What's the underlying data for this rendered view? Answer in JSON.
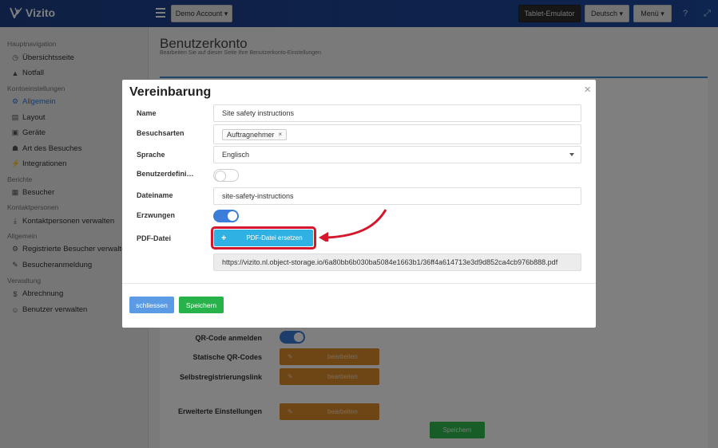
{
  "app": {
    "name": "Vizito"
  },
  "header": {
    "account_label": "Demo Account",
    "tablet_label": "Tablet-Emulator",
    "language_label": "Deutsch",
    "menu_label": "Menü"
  },
  "sidebar": {
    "sections": [
      {
        "title": "Hauptnavigation",
        "items": [
          {
            "label": "Übersichtsseite",
            "icon": "dashboard-icon"
          },
          {
            "label": "Notfall",
            "icon": "warning-icon"
          }
        ]
      },
      {
        "title": "Kontoeinstellungen",
        "items": [
          {
            "label": "Allgemein",
            "icon": "gear-icon",
            "active": true
          },
          {
            "label": "Layout",
            "icon": "layout-icon"
          },
          {
            "label": "Geräte",
            "icon": "device-icon"
          },
          {
            "label": "Art des Besuches",
            "icon": "users-icon"
          },
          {
            "label": "Integrationen",
            "icon": "plug-icon"
          }
        ]
      },
      {
        "title": "Berichte",
        "items": [
          {
            "label": "Besucher",
            "icon": "list-icon"
          }
        ]
      },
      {
        "title": "Kontaktpersonen",
        "items": [
          {
            "label": "Kontaktpersonen verwalten",
            "icon": "download-icon"
          }
        ]
      },
      {
        "title": "Allgemein",
        "items": [
          {
            "label": "Registrierte Besucher verwalten",
            "icon": "gear-icon"
          },
          {
            "label": "Besucheranmeldung",
            "icon": "pencil-icon"
          }
        ]
      },
      {
        "title": "Verwaltung",
        "items": [
          {
            "label": "Abrechnung",
            "icon": "dollar-icon"
          },
          {
            "label": "Benutzer verwalten",
            "icon": "user-plus-icon"
          }
        ]
      }
    ]
  },
  "page": {
    "title": "Benutzerkonto",
    "subtitle": "Bearbeiten Sie auf dieser Seite Ihre Benutzerkonto-Einstellungen"
  },
  "background": {
    "qr_login_label": "QR-Code anmelden",
    "static_qr_label": "Statische QR-Codes",
    "self_reg_label": "Selbstregistrierungslink",
    "advanced_label": "Erweiterte Einstellungen",
    "edit_label": "bearbeiten",
    "save_label": "Speichern"
  },
  "modal": {
    "title": "Vereinbarung",
    "close_symbol": "×",
    "fields": {
      "name_label": "Name",
      "name_value": "Site safety instructions",
      "visit_types_label": "Besuchsarten",
      "visit_type_tag": "Auftragnehmer",
      "tag_remove": "×",
      "language_label": "Sprache",
      "language_value": "Englisch",
      "custom_label": "Benutzerdefinier…",
      "custom_enabled": false,
      "filename_label": "Dateiname",
      "filename_value": "site-safety-instructions",
      "forced_label": "Erzwungen",
      "forced_enabled": true,
      "pdf_label": "PDF-Datei",
      "pdf_button_label": "PDF-Datei ersetzen",
      "pdf_button_plus": "+",
      "pdf_url": "https://vizito.nl.object-storage.io/6a80bb6b030ba5084e1663b1/36ff4a614713e3d9d852ca4cb976b888.pdf"
    },
    "close_button_label": "schliessen",
    "save_button_label": "Speichern"
  },
  "colors": {
    "primary": "#1c4aa0",
    "accent_blue": "#2fb2e3",
    "highlight_red": "#d4172a",
    "save_green": "#27b34a",
    "edit_orange": "#dd8a2a"
  }
}
